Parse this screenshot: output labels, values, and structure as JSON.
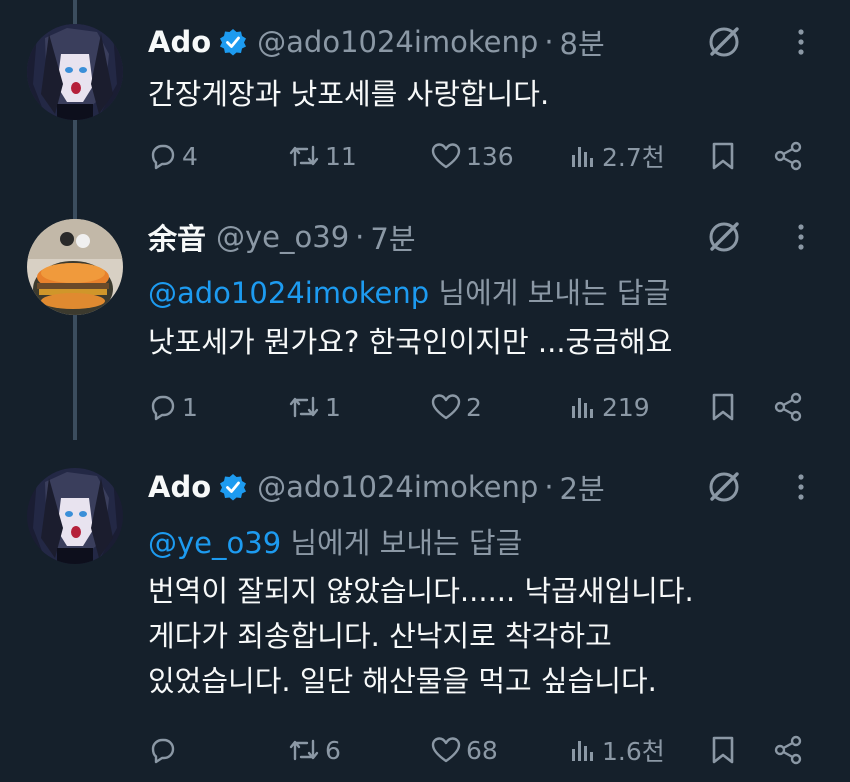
{
  "tweets": [
    {
      "name": "Ado",
      "verified": true,
      "handle": "@ado1024imokenp",
      "dot": "·",
      "time": "8분",
      "reply_to": null,
      "body": [
        "간장게장과 낫포세를 사랑합니다."
      ],
      "actions": {
        "replies": "4",
        "retweets": "11",
        "likes": "136",
        "views": "2.7천"
      }
    },
    {
      "name": "余音",
      "verified": false,
      "handle": "@ye_o39",
      "dot": "·",
      "time": "7분",
      "reply_to": {
        "mention": "@ado1024imokenp",
        "suffix": " 님에게 보내는 답글"
      },
      "body": [
        "낫포세가 뭔가요? 한국인이지만 ...궁금해요"
      ],
      "actions": {
        "replies": "1",
        "retweets": "1",
        "likes": "2",
        "views": "219"
      }
    },
    {
      "name": "Ado",
      "verified": true,
      "handle": "@ado1024imokenp",
      "dot": "·",
      "time": "2분",
      "reply_to": {
        "mention": "@ye_o39",
        "suffix": " 님에게 보내는 답글"
      },
      "body": [
        "번역이 잘되지 않았습니다...... 낙곱새입니다.",
        "게다가 죄송합니다. 산낙지로 착각하고",
        "있었습니다. 일단 해산물을 먹고 싶습니다."
      ],
      "actions": {
        "replies": "",
        "retweets": "6",
        "likes": "68",
        "views": "1.6천"
      }
    }
  ],
  "colors": {
    "background": "#15202b",
    "text": "#f7f9f9",
    "secondary": "#8b98a5",
    "accent": "#1d9bf0",
    "thread_line": "#3b4d5e"
  },
  "icons": [
    "reply-icon",
    "retweet-icon",
    "like-icon",
    "views-icon",
    "bookmark-icon",
    "share-icon",
    "grok-icon",
    "more-icon",
    "verified-badge-icon"
  ]
}
